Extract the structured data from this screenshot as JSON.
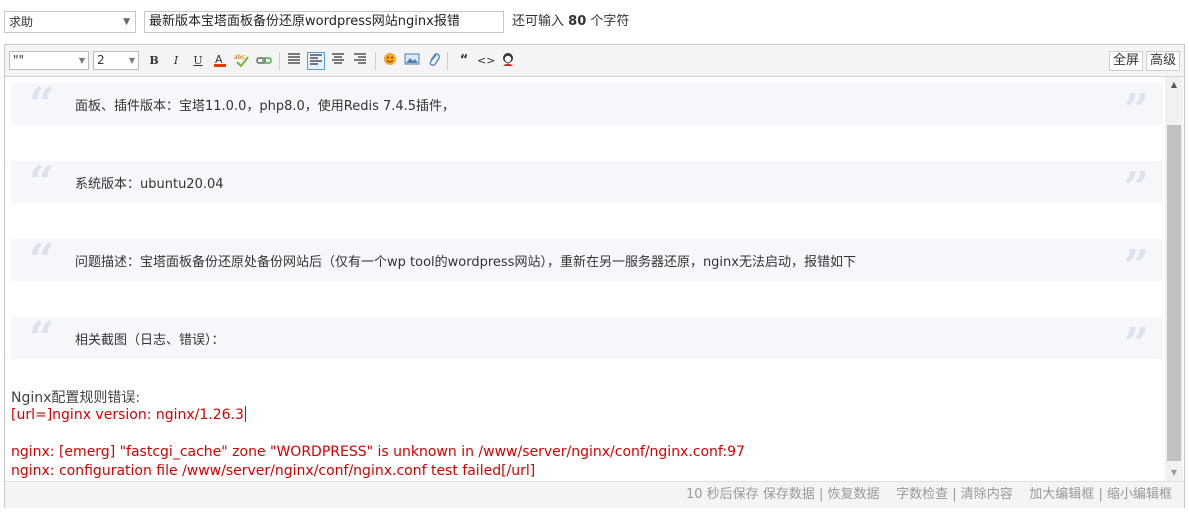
{
  "topbar": {
    "category": "求助",
    "title_value": "最新版本宝塔面板备份还原wordpress网站nginx报错",
    "counter_prefix": "还可输入",
    "counter_value": "80",
    "counter_suffix": "个字符"
  },
  "toolbar": {
    "font_family": "\"\"",
    "font_size": "2",
    "bold": "B",
    "italic": "I",
    "underline": "U",
    "fullscreen": "全屏",
    "advanced": "高级",
    "icons": [
      "bold-icon",
      "italic-icon",
      "underline-icon",
      "font-color-icon",
      "spellcheck-icon",
      "link-icon",
      "align-justify-icon",
      "align-left-icon",
      "align-center-icon",
      "align-right-icon",
      "emoji-icon",
      "image-icon",
      "attachment-icon",
      "quote-icon",
      "code-icon",
      "avatar-icon"
    ]
  },
  "content": {
    "quotes": [
      "面板、插件版本：宝塔11.0.0，php8.0，使用Redis 7.4.5插件，",
      "系统版本：ubuntu20.04",
      "问题描述：宝塔面板备份还原处备份网站后（仅有一个wp tool的wordpress网站），重新在另一服务器还原，nginx无法启动，报错如下",
      "相关截图（日志、错误）："
    ],
    "lines": [
      "Nginx配置规则错误:",
      "[url=]nginx version: nginx/1.26.3",
      "nginx: [emerg] \"fastcgi_cache\" zone \"WORDPRESS\" is unknown in /www/server/nginx/conf/nginx.conf:97",
      "nginx: configuration file /www/server/nginx/conf/nginx.conf test failed[/url]"
    ]
  },
  "status": {
    "autosave": "10 秒后保存",
    "save_data": "保存数据",
    "restore_data": "恢复数据",
    "word_check": "字数检查",
    "clear": "清除内容",
    "enlarge": "加大编辑框",
    "shrink": "缩小编辑框",
    "sep": "|"
  },
  "colors": {
    "error_text": "#d40000",
    "quote_bg": "#f6f7fb",
    "quote_mark": "#dde3ee"
  }
}
